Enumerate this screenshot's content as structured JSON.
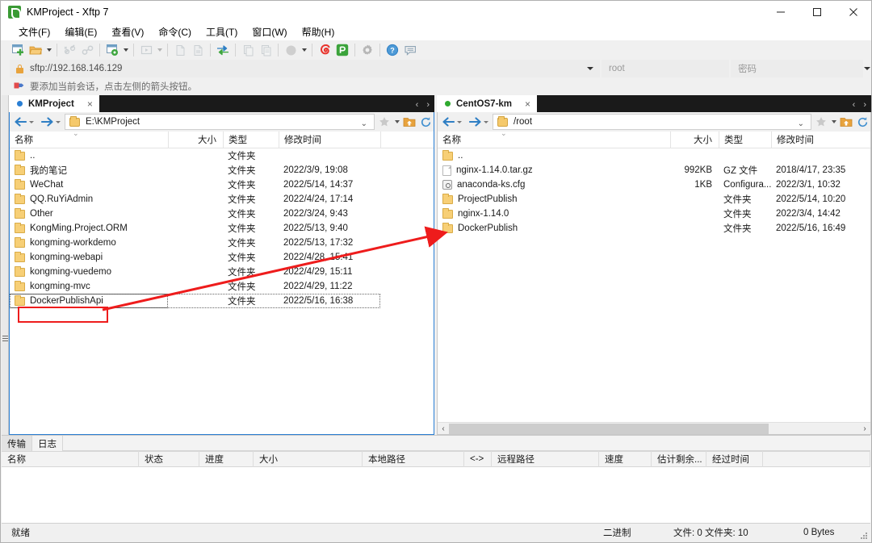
{
  "window": {
    "title": "KMProject - Xftp 7",
    "app_icon": "xftp-logo-icon",
    "minimize": "minimize-icon",
    "maximize": "maximize-icon",
    "close": "close-icon"
  },
  "menu": {
    "items": [
      {
        "label": "文件(F)"
      },
      {
        "label": "编辑(E)"
      },
      {
        "label": "查看(V)"
      },
      {
        "label": "命令(C)"
      },
      {
        "label": "工具(T)"
      },
      {
        "label": "窗口(W)"
      },
      {
        "label": "帮助(H)"
      }
    ]
  },
  "toolbar": {
    "buttons": [
      {
        "name": "new-session-icon",
        "enabled": true
      },
      {
        "name": "open-folder-icon",
        "enabled": true
      },
      {
        "name": "open-folder-dropdown-caret",
        "enabled": true
      },
      {
        "name": "separator-1"
      },
      {
        "name": "disconnect-icon",
        "enabled": false
      },
      {
        "name": "reconnect-icon",
        "enabled": false
      },
      {
        "name": "separator-2"
      },
      {
        "name": "session-settings-icon",
        "enabled": true
      },
      {
        "name": "session-settings-dropdown-caret",
        "enabled": true
      },
      {
        "name": "separator-3"
      },
      {
        "name": "terminal-icon",
        "enabled": false
      },
      {
        "name": "terminal-dropdown-caret",
        "enabled": false
      },
      {
        "name": "separator-4"
      },
      {
        "name": "new-file-icon",
        "enabled": false
      },
      {
        "name": "edit-file-icon",
        "enabled": false
      },
      {
        "name": "separator-5"
      },
      {
        "name": "transfer-sync-icon",
        "enabled": true
      },
      {
        "name": "separator-6"
      },
      {
        "name": "copy-icon",
        "enabled": false
      },
      {
        "name": "paste-icon",
        "enabled": false
      },
      {
        "name": "separator-7"
      },
      {
        "name": "transfer-mode-icon",
        "enabled": false
      },
      {
        "name": "transfer-mode-dropdown-caret",
        "enabled": false
      },
      {
        "name": "separator-8"
      },
      {
        "name": "xshell-icon",
        "enabled": true
      },
      {
        "name": "xftp-icon",
        "enabled": true
      },
      {
        "name": "separator-9"
      },
      {
        "name": "options-gear-icon",
        "enabled": true
      },
      {
        "name": "separator-10"
      },
      {
        "name": "help-icon",
        "enabled": true
      },
      {
        "name": "feedback-icon",
        "enabled": true
      }
    ]
  },
  "address": {
    "host_value": "sftp://192.168.146.129",
    "host_icon": "lock-icon",
    "user_value": "root",
    "user_placeholder": "root",
    "password_placeholder": "密码",
    "dropdown_caret": "chevron-down-icon"
  },
  "hint": {
    "icon": "bookmark-flag-icon",
    "text": "要添加当前会话，点击左侧的箭头按钮。"
  },
  "left_panel": {
    "tab": {
      "label": "KMProject",
      "status": "connected-local",
      "close": "×"
    },
    "tab_nav": {
      "prev": "‹",
      "next": "›"
    },
    "path": {
      "value": "E:\\KMProject",
      "folder_icon": "folder-icon",
      "chevron": "chevron-down-icon"
    },
    "path_buttons": [
      {
        "name": "bookmark-star-icon"
      },
      {
        "name": "bookmark-dropdown-caret"
      },
      {
        "name": "parent-folder-icon"
      },
      {
        "name": "refresh-icon"
      }
    ],
    "columns": [
      {
        "label": "名称"
      },
      {
        "label": "大小"
      },
      {
        "label": "类型"
      },
      {
        "label": "修改时间"
      }
    ],
    "rows": [
      {
        "icon": "folder-icon",
        "name": "..",
        "size": "",
        "type": "文件夹",
        "modified": ""
      },
      {
        "icon": "folder-icon",
        "name": "我的笔记",
        "size": "",
        "type": "文件夹",
        "modified": "2022/3/9, 19:08"
      },
      {
        "icon": "folder-icon",
        "name": "WeChat",
        "size": "",
        "type": "文件夹",
        "modified": "2022/5/14, 14:37"
      },
      {
        "icon": "folder-icon",
        "name": "QQ.RuYiAdmin",
        "size": "",
        "type": "文件夹",
        "modified": "2022/4/24, 17:14"
      },
      {
        "icon": "folder-icon",
        "name": "Other",
        "size": "",
        "type": "文件夹",
        "modified": "2022/3/24, 9:43"
      },
      {
        "icon": "folder-icon",
        "name": "KongMing.Project.ORM",
        "size": "",
        "type": "文件夹",
        "modified": "2022/5/13, 9:40"
      },
      {
        "icon": "folder-icon",
        "name": "kongming-workdemo",
        "size": "",
        "type": "文件夹",
        "modified": "2022/5/13, 17:32"
      },
      {
        "icon": "folder-icon",
        "name": "kongming-webapi",
        "size": "",
        "type": "文件夹",
        "modified": "2022/4/28, 15:41"
      },
      {
        "icon": "folder-icon",
        "name": "kongming-vuedemo",
        "size": "",
        "type": "文件夹",
        "modified": "2022/4/29, 15:11"
      },
      {
        "icon": "folder-icon",
        "name": "kongming-mvc",
        "size": "",
        "type": "文件夹",
        "modified": "2022/4/29, 11:22"
      },
      {
        "icon": "folder-icon",
        "name": "DockerPublishApi",
        "size": "",
        "type": "文件夹",
        "modified": "2022/5/16, 16:38",
        "selected": true,
        "highlighted": true
      }
    ]
  },
  "right_panel": {
    "tab": {
      "label": "CentOS7-km",
      "status": "connected-remote",
      "close": "×"
    },
    "tab_nav": {
      "prev": "‹",
      "next": "›"
    },
    "path": {
      "value": "/root",
      "folder_icon": "folder-icon",
      "chevron": "chevron-down-icon"
    },
    "path_buttons": [
      {
        "name": "bookmark-star-icon"
      },
      {
        "name": "bookmark-dropdown-caret"
      },
      {
        "name": "parent-folder-icon"
      },
      {
        "name": "refresh-icon"
      }
    ],
    "columns": [
      {
        "label": "名称"
      },
      {
        "label": "大小"
      },
      {
        "label": "类型"
      },
      {
        "label": "修改时间"
      }
    ],
    "rows": [
      {
        "icon": "folder-icon",
        "name": "..",
        "size": "",
        "type": "",
        "modified": ""
      },
      {
        "icon": "file-icon",
        "name": "nginx-1.14.0.tar.gz",
        "size": "992KB",
        "type": "GZ 文件",
        "modified": "2018/4/17, 23:35"
      },
      {
        "icon": "config-icon",
        "name": "anaconda-ks.cfg",
        "size": "1KB",
        "type": "Configura...",
        "modified": "2022/3/1, 10:32"
      },
      {
        "icon": "folder-icon",
        "name": "ProjectPublish",
        "size": "",
        "type": "文件夹",
        "modified": "2022/5/14, 10:20"
      },
      {
        "icon": "folder-icon",
        "name": "nginx-1.14.0",
        "size": "",
        "type": "文件夹",
        "modified": "2022/3/4, 14:42"
      },
      {
        "icon": "folder-icon",
        "name": "DockerPublish",
        "size": "",
        "type": "文件夹",
        "modified": "2022/5/16, 16:49",
        "drop_target": true
      }
    ],
    "hscroll": {
      "left_arrow": "‹",
      "right_arrow": "›"
    }
  },
  "transfer_pane": {
    "tabs": [
      {
        "label": "传输",
        "active": true
      },
      {
        "label": "日志",
        "active": false
      }
    ],
    "columns": [
      {
        "label": "名称"
      },
      {
        "label": "状态"
      },
      {
        "label": "进度"
      },
      {
        "label": "大小"
      },
      {
        "label": "本地路径"
      },
      {
        "label": "<->"
      },
      {
        "label": "远程路径"
      },
      {
        "label": "速度"
      },
      {
        "label": "估计剩余..."
      },
      {
        "label": "经过时间"
      }
    ],
    "rows": []
  },
  "statusbar": {
    "ready": "就绪",
    "mode": "二进制",
    "counts": "文件: 0 文件夹: 10",
    "bytes": "0 Bytes"
  },
  "annotation": {
    "arrow_color": "#ee1c1c",
    "box_color": "#ee1c1c",
    "description": "drag DockerPublishApi folder to remote /root"
  }
}
